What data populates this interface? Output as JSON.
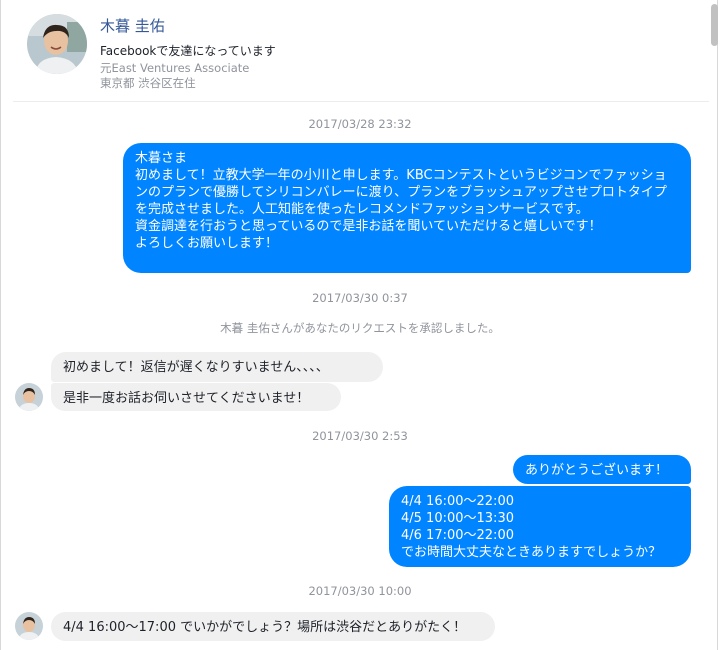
{
  "profile": {
    "name": "木暮 圭佑",
    "friend_status": "Facebookで友達になっています",
    "work": "元East Ventures Associate",
    "location": "東京都 渋谷区在住"
  },
  "conversation": {
    "timestamps": [
      "2017/03/28 23:32",
      "2017/03/30 0:37",
      "2017/03/30 2:53",
      "2017/03/30 10:00"
    ],
    "system_message": "木暮 圭佑さんがあなたのリクエストを承認しました。",
    "messages": [
      {
        "sender": "me",
        "text": "木暮さま\n初めまして！立教大学一年の小川と申します。KBCコンテストというビジコンでファッションのプランで優勝してシリコンバレーに渡り、プランをブラッシュアップさせプロトタイプを完成させました。人工知能を使ったレコメンドファッションサービスです。\n資金調達を行おうと思っているので是非お話を聞いていただけると嬉しいです！\nよろしくお願いします！"
      },
      {
        "sender": "them",
        "text": "初めまして！返信が遅くなりすいません、、、、"
      },
      {
        "sender": "them",
        "text": "是非一度お話お伺いさせてくださいませ！"
      },
      {
        "sender": "me",
        "text": "ありがとうございます！"
      },
      {
        "sender": "me",
        "text": "4/4 16:00〜22:00\n4/5 10:00〜13:30\n4/6 17:00〜22:00\nでお時間大丈夫なときありますでしょうか？"
      },
      {
        "sender": "them",
        "text": "4/4 16:00〜17:00 でいかがでしょう？場所は渋谷だとありがたく！"
      }
    ]
  },
  "colors": {
    "outgoing_bubble": "#0084ff",
    "incoming_bubble": "#f1f0f0",
    "name_link": "#365899",
    "meta_text": "#90949c"
  },
  "icons": {
    "avatar": "person-avatar",
    "scrollbar": "scrollbar-thumb"
  }
}
